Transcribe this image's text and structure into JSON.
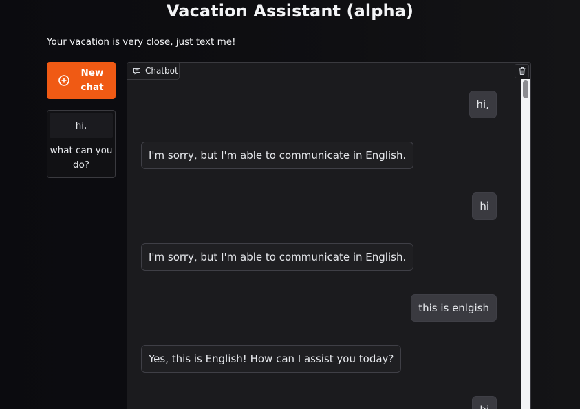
{
  "header": {
    "title": "Vacation Assistant (alpha)",
    "subtitle": "Your vacation is very close, just text me!"
  },
  "sidebar": {
    "new_chat_label": "New chat",
    "new_chat_icon": "plus-circle-icon",
    "history": [
      {
        "label": "hi,"
      },
      {
        "label": "what can you do?"
      }
    ]
  },
  "chatbot": {
    "label": "Chatbot",
    "label_icon": "chat-bubble-icon",
    "clear_icon": "trash-icon",
    "messages": [
      {
        "role": "user",
        "text": "hi,"
      },
      {
        "role": "bot",
        "text": "I'm sorry, but I'm able to communicate in English."
      },
      {
        "role": "user",
        "text": "hi"
      },
      {
        "role": "bot",
        "text": "I'm sorry, but I'm able to communicate in English."
      },
      {
        "role": "user",
        "text": "this is enlgish"
      },
      {
        "role": "bot",
        "text": "Yes, this is English! How can I assist you today?"
      },
      {
        "role": "user",
        "text": "hi"
      }
    ]
  },
  "colors": {
    "accent": "#f05a14",
    "background": "#0b0b0f",
    "panel": "#1b1b1e",
    "user_bubble": "#3a3a40"
  }
}
